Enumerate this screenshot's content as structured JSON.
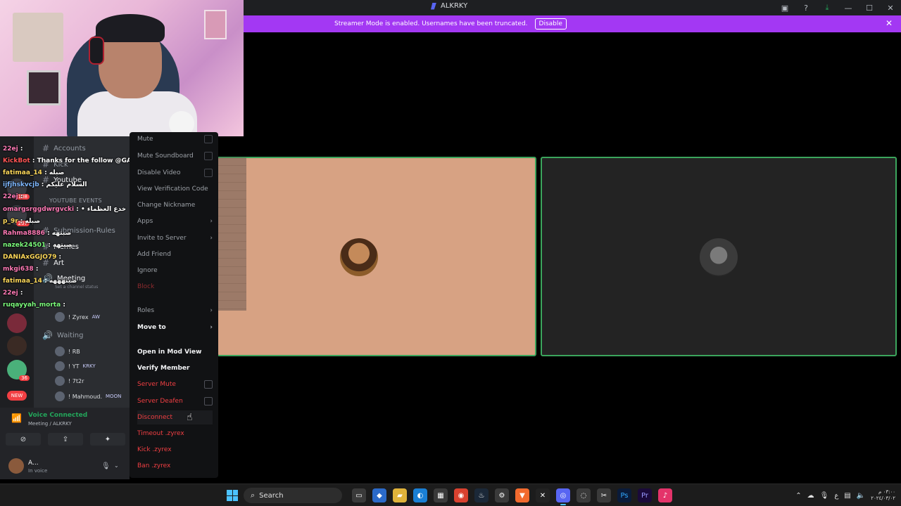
{
  "app": {
    "title": "ALKRKY"
  },
  "banner": {
    "text": "Streamer Mode is enabled. Usernames have been truncated.",
    "button": "Disable"
  },
  "channels": {
    "accounts": "Accounts",
    "kick": "Kick",
    "youtube": "Youtube",
    "category": "YOUTUBE EVENTS",
    "submission": "Submission-Rules",
    "memes": "Memes",
    "art": "Art",
    "meeting": "Meeting",
    "meeting_status": "Set a channel status",
    "waiting": "Waiting"
  },
  "voice_users": [
    {
      "name": "! Zyrex",
      "tag": "AW"
    },
    {
      "name": "! RB",
      "tag": ""
    },
    {
      "name": "! YT",
      "tag": "KRKY"
    },
    {
      "name": "! 7t2r",
      "tag": ""
    },
    {
      "name": "! Mahmoud.",
      "tag": "MOON"
    }
  ],
  "chat": [
    {
      "user": "22ej",
      "text": ":",
      "color": "pink"
    },
    {
      "user": "KickBot",
      "text": ": Thanks for the follow @GAGLO",
      "color": "red"
    },
    {
      "user": "fatimaa_14",
      "text": ": صبله",
      "color": "yellow"
    },
    {
      "user": "ijfjhskvcjb",
      "text": ": السلام عليكم",
      "color": "blue"
    },
    {
      "user": "22ej",
      "text": ":",
      "color": "pink"
    },
    {
      "user": "omargsrggdwrgvcki",
      "text": ": • خدع العظماء",
      "color": "pink"
    },
    {
      "user": "p_9r",
      "text": ": صبله",
      "color": "yellow"
    },
    {
      "user": "Rahma8886",
      "text": ": صبتهه",
      "color": "pink"
    },
    {
      "user": "nazek24501",
      "text": ": صبتهه",
      "color": "green"
    },
    {
      "user": "DANIAxGGJO79",
      "text": ":",
      "color": "yellow"
    },
    {
      "user": "mkgi638",
      "text": ":",
      "color": "pink"
    },
    {
      "user": "fatimaa_14",
      "text": ": صبتهههه",
      "color": "yellow"
    },
    {
      "user": "22ej",
      "text": ":",
      "color": "pink"
    },
    {
      "user": "ruqayyah_morta",
      "text": ":",
      "color": "green"
    }
  ],
  "menu": {
    "mute": "Mute",
    "mute_soundboard": "Mute Soundboard",
    "disable_video": "Disable Video",
    "view_verification": "View Verification Code",
    "change_nickname": "Change Nickname",
    "apps": "Apps",
    "invite": "Invite to Server",
    "add_friend": "Add Friend",
    "ignore": "Ignore",
    "block": "Block",
    "roles": "Roles",
    "move_to": "Move to",
    "mod_view": "Open in Mod View",
    "verify": "Verify Member",
    "server_mute": "Server Mute",
    "server_deafen": "Server Deafen",
    "disconnect": "Disconnect",
    "timeout": "Timeout .zyrex",
    "kick": "Kick .zyrex",
    "ban": "Ban .zyrex"
  },
  "voice_panel": {
    "title": "Voice Connected",
    "subtitle": "Meeting / ALKRKY"
  },
  "user": {
    "name": "A...",
    "status": "In voice"
  },
  "guild_badges": {
    "b1": "108",
    "b2": "207",
    "b3": "36",
    "new": "NEW"
  },
  "taskbar": {
    "search": "Search",
    "tray_lang": "ع",
    "time": "٠٣:٠٠ م",
    "date": "٢٠٢٤/٠٣/٠٢"
  }
}
